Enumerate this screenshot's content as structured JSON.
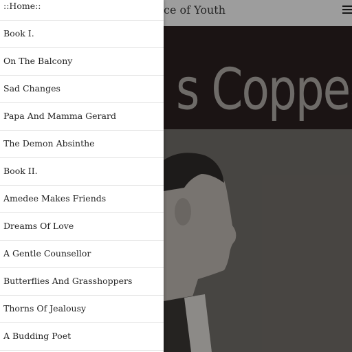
{
  "header": {
    "title": "ce of Youth",
    "menu_icon": "hamburger-menu-icon"
  },
  "cover": {
    "title_text": "s Coppee"
  },
  "drawer": {
    "items": [
      {
        "label": "::Home::"
      },
      {
        "label": "Book I."
      },
      {
        "label": "On The Balcony"
      },
      {
        "label": "Sad Changes"
      },
      {
        "label": "Papa And Mamma Gerard"
      },
      {
        "label": "The Demon Absinthe"
      },
      {
        "label": "Book II."
      },
      {
        "label": "Amedee Makes Friends"
      },
      {
        "label": "Dreams Of Love"
      },
      {
        "label": "A Gentle Counsellor"
      },
      {
        "label": "Butterflies And Grasshoppers"
      },
      {
        "label": "Thorns Of Jealousy"
      },
      {
        "label": "A Budding Poet"
      }
    ]
  }
}
